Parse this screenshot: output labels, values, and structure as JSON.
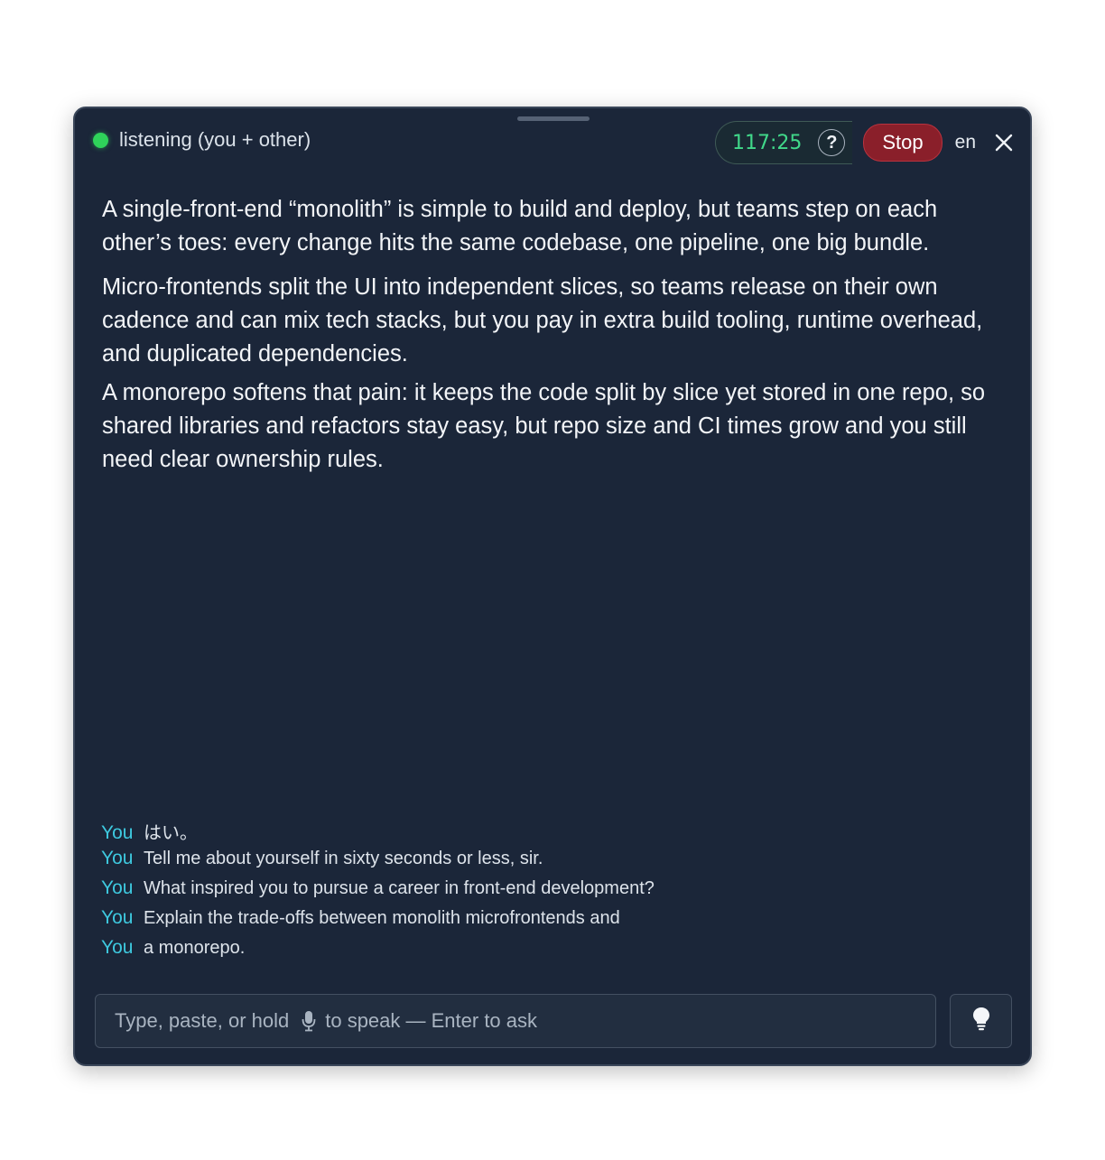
{
  "header": {
    "status_text": "listening (you + other)",
    "status_color": "#2fd35a",
    "timer": "117:25",
    "help_label": "?",
    "stop_label": "Stop",
    "language": "en"
  },
  "answer": {
    "paragraphs": [
      "A single-front-end “monolith” is simple to build and deploy, but teams step on each other’s toes: every change hits the same codebase, one pipeline, one big bundle.",
      "Micro-frontends split the UI into independent slices, so teams release on their own cadence and can mix tech stacks, but you pay in extra build tooling, runtime overhead, and duplicated dependencies.",
      "A monorepo softens that pain: it keeps the code split by slice yet stored in one repo, so shared libraries and refactors stay easy, but repo size and CI times grow and you still need clear ownership rules."
    ]
  },
  "transcript": [
    {
      "speaker": "You",
      "text": "はい。"
    },
    {
      "speaker": "You",
      "text": "Tell me about yourself in sixty seconds or less, sir."
    },
    {
      "speaker": "You",
      "text": "What inspired you to pursue a career in front-end development?"
    },
    {
      "speaker": "You",
      "text": "Explain the trade-offs between monolith microfrontends and"
    },
    {
      "speaker": "You",
      "text": "a monorepo."
    }
  ],
  "input": {
    "placeholder_before": "Type, paste, or hold",
    "placeholder_after": "to speak — Enter to ask"
  },
  "icons": {
    "mic": "microphone-icon",
    "hint": "lightbulb-icon",
    "close": "close-icon"
  },
  "colors": {
    "background": "#1b2639",
    "speaker": "#3ec9df",
    "timer": "#41d98a",
    "stop": "#8a1f2a"
  }
}
